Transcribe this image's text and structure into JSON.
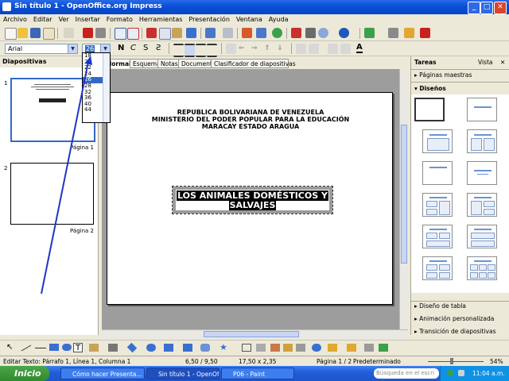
{
  "window": {
    "title": "Sin título 1 - OpenOffice.org Impress",
    "controls": {
      "minimize": "_",
      "maximize": "□",
      "close": "✕"
    }
  },
  "menu": [
    "Archivo",
    "Editar",
    "Ver",
    "Insertar",
    "Formato",
    "Herramientas",
    "Presentación",
    "Ventana",
    "Ayuda"
  ],
  "format_bar": {
    "font_name": "Arial",
    "font_size": "26",
    "font_sizes": [
      "18",
      "20",
      "22",
      "24",
      "26",
      "28",
      "32",
      "36",
      "40",
      "44"
    ],
    "selected_size": "26",
    "bold_label": "N",
    "italic_label": "C",
    "shadow_label": "S"
  },
  "slides_panel": {
    "title": "Diapositivas",
    "slides": [
      {
        "number": "1",
        "label": "Página 1"
      },
      {
        "number": "2",
        "label": "Página 2"
      }
    ]
  },
  "view_tabs": [
    "Normal",
    "Esquema",
    "Notas",
    "Documento",
    "Clasificador de diapositivas"
  ],
  "slide": {
    "header_lines": [
      "REPUBLICA BOLIVARIANA DE VENEZUELA",
      "MINISTERIO DEL PODER POPULAR PARA LA EDUCACIÓN",
      "MARACAY ESTADO ARAGUA"
    ],
    "title_lines": [
      "LOS ANIMALES DOMÉSTICOS Y",
      "SALVAJES"
    ]
  },
  "task_panel": {
    "title": "Tareas",
    "view_label": "Vista",
    "sections": {
      "master_pages": "Páginas maestras",
      "designs": "Diseños",
      "table_design": "Diseño de tabla",
      "custom_animation": "Animación personalizada",
      "slide_transition": "Transición de diapositivas"
    }
  },
  "status_bar": {
    "edit_text": "Editar Texto: Párrafo 1, Línea 1, Columna 1",
    "position": "6,50 / 9,50",
    "size": "17,50 x 2,35",
    "page": "Página 1 / 2",
    "style": "Predeterminado",
    "zoom": "54%"
  },
  "taskbar": {
    "start": "Inicio",
    "tasks": [
      "Cómo hacer Presenta...",
      "Sin título 1 - OpenOffi...",
      "P06 - Paint"
    ],
    "search_placeholder": "Búsqueda en el escri",
    "clock": "11:04 a.m."
  },
  "colors": {
    "title_bar": "#0a4fd6",
    "selection": "#316ac5",
    "workspace": "#9d9d9d",
    "annotation_arrow": "#1f35c8"
  },
  "icons": [
    "new-doc-icon",
    "open-icon",
    "save-icon",
    "email-icon",
    "edit-icon",
    "pdf-icon",
    "print-icon",
    "print-direct-icon",
    "spellcheck-icon",
    "autospell-icon",
    "cut-icon",
    "copy-icon",
    "paste-icon",
    "format-paintbrush-icon",
    "undo-icon",
    "redo-icon",
    "chart-icon",
    "table-icon",
    "navigator-icon",
    "gallery-icon",
    "zoom-icon",
    "help-icon"
  ]
}
